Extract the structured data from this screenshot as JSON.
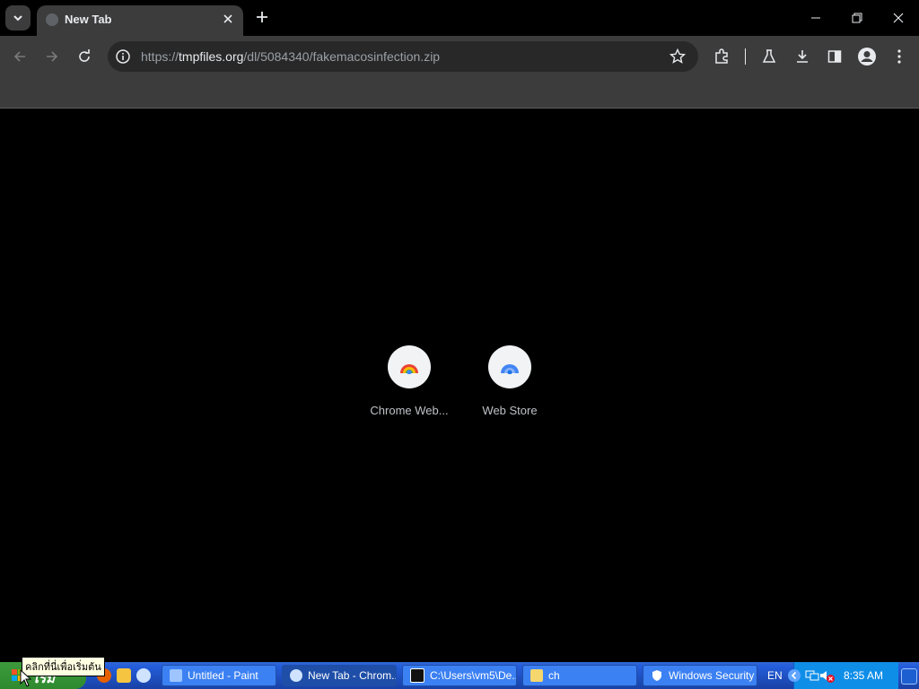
{
  "browser": {
    "tab": {
      "title": "New Tab"
    },
    "url": {
      "scheme": "https://",
      "host": "tmpfiles.org",
      "path": "/dl/5084340/fakemacosinfection.zip"
    },
    "shortcuts": [
      {
        "label": "Chrome Web..."
      },
      {
        "label": "Web Store"
      }
    ]
  },
  "taskbar": {
    "start_label": "เริ่ม",
    "start_tooltip": "คลิกที่นี่เพื่อเริ่มต้น",
    "tasks": [
      {
        "label": "Untitled - Paint"
      },
      {
        "label": "New Tab - Chrom..."
      },
      {
        "label": "C:\\Users\\vm5\\De..."
      },
      {
        "label": "ch"
      },
      {
        "label": "Windows Security"
      }
    ],
    "language": "EN",
    "clock": "8:35 AM"
  },
  "colors": {
    "accent": "#3c3c3c",
    "taskbar": "#245edb",
    "start": "#2f8a2f"
  }
}
